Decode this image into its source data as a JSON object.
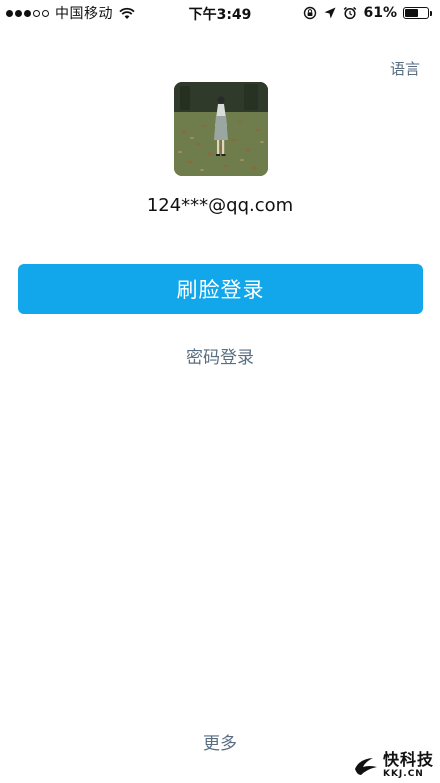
{
  "status_bar": {
    "carrier": "中国移动",
    "time": "下午3:49",
    "battery_percent": "61%",
    "battery_level": 0.61,
    "signal_strength": 3,
    "signal_max": 5,
    "icons": [
      "wifi-icon",
      "orientation-lock-icon",
      "location-arrow-icon",
      "alarm-icon",
      "battery-icon"
    ]
  },
  "header": {
    "language_label": "语言"
  },
  "account": {
    "avatar": "profile-photo",
    "display_name": "124***@qq.com"
  },
  "actions": {
    "face_login_label": "刷脸登录",
    "password_login_label": "密码登录",
    "more_label": "更多"
  },
  "watermark": {
    "brand_cn": "快科技",
    "brand_en": "KKJ.CN"
  },
  "colors": {
    "primary_button": "#12a7ea",
    "link_text": "#5a6e82",
    "background": "#ffffff"
  }
}
